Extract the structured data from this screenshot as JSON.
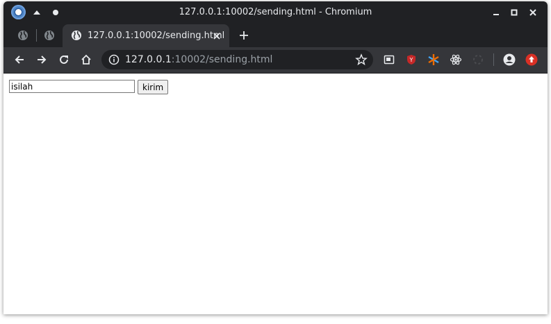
{
  "window": {
    "title": "127.0.0.1:10002/sending.html - Chromium"
  },
  "tabs": [
    {
      "title": "127.0.0.1:10002/sending.html",
      "active": true
    }
  ],
  "toolbar": {
    "url_host": "127.0.0.1",
    "url_rest": ":10002/sending.html"
  },
  "page": {
    "input_value": "isilah",
    "button_label": "kirim"
  },
  "colors": {
    "frame": "#202124",
    "toolbar": "#35363a",
    "text": "#e8eaed",
    "muted": "#9aa0a6"
  },
  "icons": [
    "chromium-logo-icon",
    "minimize-up-icon",
    "dot-icon",
    "globe-icon",
    "close-icon",
    "plus-icon",
    "back-arrow-icon",
    "forward-arrow-icon",
    "reload-icon",
    "home-icon",
    "info-icon",
    "star-icon",
    "extension-icons",
    "profile-icon",
    "update-icon",
    "minimize-icon",
    "maximize-icon"
  ]
}
